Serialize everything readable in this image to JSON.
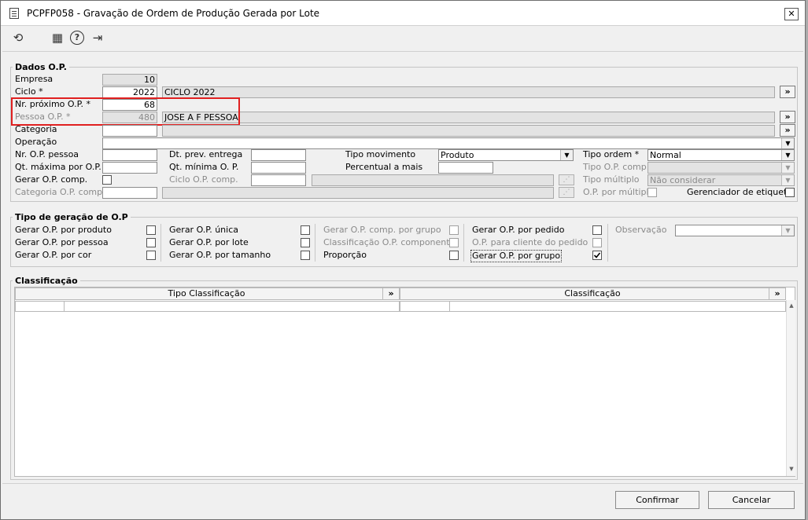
{
  "window": {
    "title": "PCPFP058 - Gravação de Ordem de Produção Gerada por Lote",
    "close": "✕"
  },
  "toolbar": {
    "refresh": "⟲",
    "calendar": "▦",
    "help": "?",
    "exit": "⇥"
  },
  "dados": {
    "title": "Dados O.P.",
    "empresa": {
      "label": "Empresa",
      "value": "10"
    },
    "ciclo": {
      "label": "Ciclo *",
      "value": "2022",
      "desc": "CICLO 2022"
    },
    "nr_proximo": {
      "label": "Nr. próximo O.P. *",
      "value": "68"
    },
    "pessoa": {
      "label": "Pessoa O.P. *",
      "value": "480",
      "desc": "JOSE A F PESSOA"
    },
    "categoria": {
      "label": "Categoria"
    },
    "operacao": {
      "label": "Operação"
    },
    "nr_op_pessoa": {
      "label": "Nr. O.P. pessoa"
    },
    "dt_prev_entrega": {
      "label": "Dt. prev. entrega"
    },
    "tipo_movimento": {
      "label": "Tipo movimento",
      "value": "Produto"
    },
    "tipo_ordem": {
      "label": "Tipo ordem *",
      "value": "Normal"
    },
    "qt_maxima": {
      "label": "Qt. máxima por O.P."
    },
    "qt_minima": {
      "label": "Qt. mínima O. P."
    },
    "percentual": {
      "label": "Percentual a mais"
    },
    "tipo_op_comp": {
      "label": "Tipo O.P. comp."
    },
    "gerar_op_comp": {
      "label": "Gerar O.P. comp."
    },
    "ciclo_op_comp": {
      "label": "Ciclo O.P. comp."
    },
    "tipo_multiplo": {
      "label": "Tipo múltiplo",
      "value": "Não considerar"
    },
    "categoria_op_comp": {
      "label": "Categoria O.P. comp."
    },
    "op_por_multiplo": {
      "label": "O.P. por múltiplo"
    },
    "gerenciador": {
      "label": "Gerenciador de etiqueta"
    }
  },
  "tipo_geracao": {
    "title": "Tipo de geração de O.P",
    "col1": [
      "Gerar O.P. por produto",
      "Gerar O.P. por pessoa",
      "Gerar O.P. por cor"
    ],
    "col2": [
      "Gerar O.P. única",
      "Gerar O.P. por lote",
      "Gerar O.P. por tamanho"
    ],
    "col3": [
      "Gerar O.P. comp. por grupo",
      "Classificação O.P. componente",
      "Proporção"
    ],
    "col4": [
      "Gerar O.P. por pedido",
      "O.P. para cliente do pedido",
      "Gerar O.P. por grupo"
    ],
    "observacao": "Observação"
  },
  "classificacao": {
    "title": "Classificação",
    "col_tipo": "Tipo Classificação",
    "col_class": "Classificação",
    "pick": "»"
  },
  "buttons": {
    "confirmar": "Confirmar",
    "cancelar": "Cancelar"
  },
  "colors": {
    "highlight": "#e02020",
    "readonly": "#e3e3e3",
    "window_bg": "#f0f0f0"
  }
}
